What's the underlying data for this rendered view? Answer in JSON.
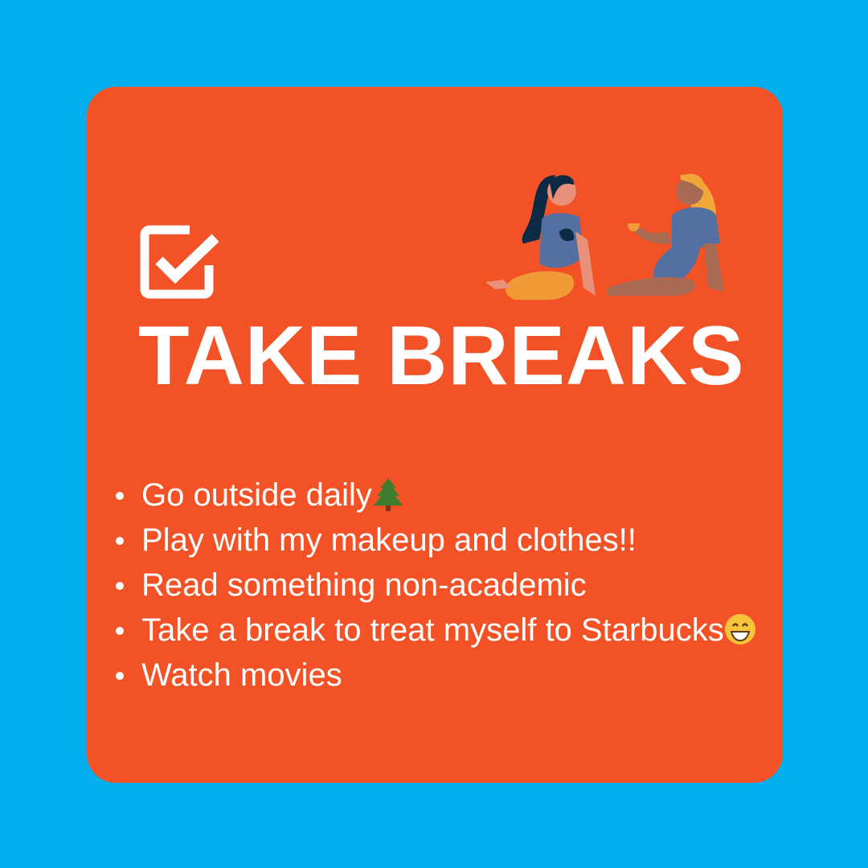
{
  "colors": {
    "background": "#03aeef",
    "card": "#f25225",
    "text": "#ffffff"
  },
  "title": "TAKE BREAKS",
  "icons": {
    "checkbox": "checked-box-icon",
    "illustration": "two-women-having-coffee",
    "tree": "evergreen-tree-emoji",
    "smile": "grinning-face-emoji"
  },
  "items": [
    {
      "text": "Go outside daily",
      "emoji": "evergreen-tree"
    },
    {
      "text": "Play with my makeup and clothes!!"
    },
    {
      "text": "Read something non-academic"
    },
    {
      "text": "Take a break to treat myself to Starbucks",
      "emoji": "grinning-face"
    },
    {
      "text": "Watch movies"
    }
  ]
}
